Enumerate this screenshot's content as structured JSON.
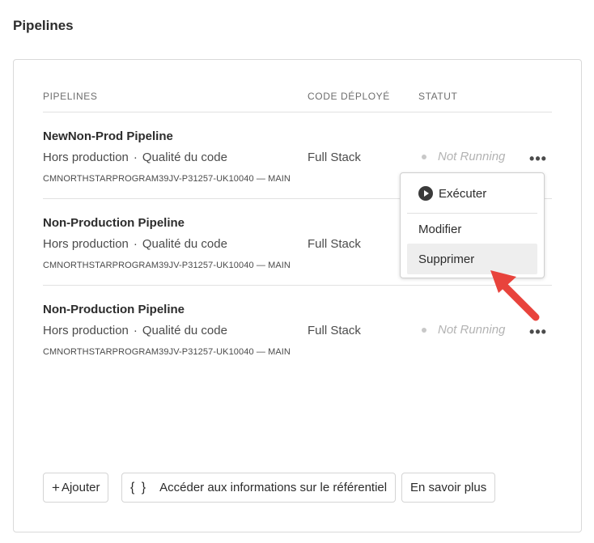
{
  "page": {
    "title": "Pipelines"
  },
  "table": {
    "headers": {
      "name": "PIPELINES",
      "code": "CODE DÉPLOYÉ",
      "status": "STATUT"
    },
    "rows": [
      {
        "name": "NewNon-Prod Pipeline",
        "env": "Hors production",
        "type": "Qualité du code",
        "branch": "CMNORTHSTARPROGRAM39JV-P31257-UK10040 — MAIN",
        "code": "Full Stack",
        "status": "Not Running",
        "more": "•••"
      },
      {
        "name": "Non-Production Pipeline",
        "env": "Hors production",
        "type": "Qualité du code",
        "branch": "CMNORTHSTARPROGRAM39JV-P31257-UK10040 — MAIN",
        "code": "Full Stack",
        "status": "",
        "more": ""
      },
      {
        "name": "Non-Production Pipeline",
        "env": "Hors production",
        "type": "Qualité du code",
        "branch": "CMNORTHSTARPROGRAM39JV-P31257-UK10040 — MAIN",
        "code": "Full Stack",
        "status": "Not Running",
        "more": "•••"
      }
    ],
    "separator": "·"
  },
  "context_menu": {
    "run": "Exécuter",
    "edit": "Modifier",
    "delete": "Supprimer",
    "hovered": "delete"
  },
  "footer": {
    "add_glyph": "+",
    "add_label": "Ajouter",
    "repo_glyph": "{ }",
    "repo_label": "Accéder aux informations sur le référentiel",
    "learn_label": "En savoir plus"
  },
  "colors": {
    "annotation_arrow": "#e8433c",
    "menu_hover": "#eeeeee",
    "status_text": "#b3b3b3"
  },
  "icons": {
    "play": "play-circle-icon",
    "more": "more-horizontal-icon",
    "annotation": "red-arrow-annotation"
  }
}
